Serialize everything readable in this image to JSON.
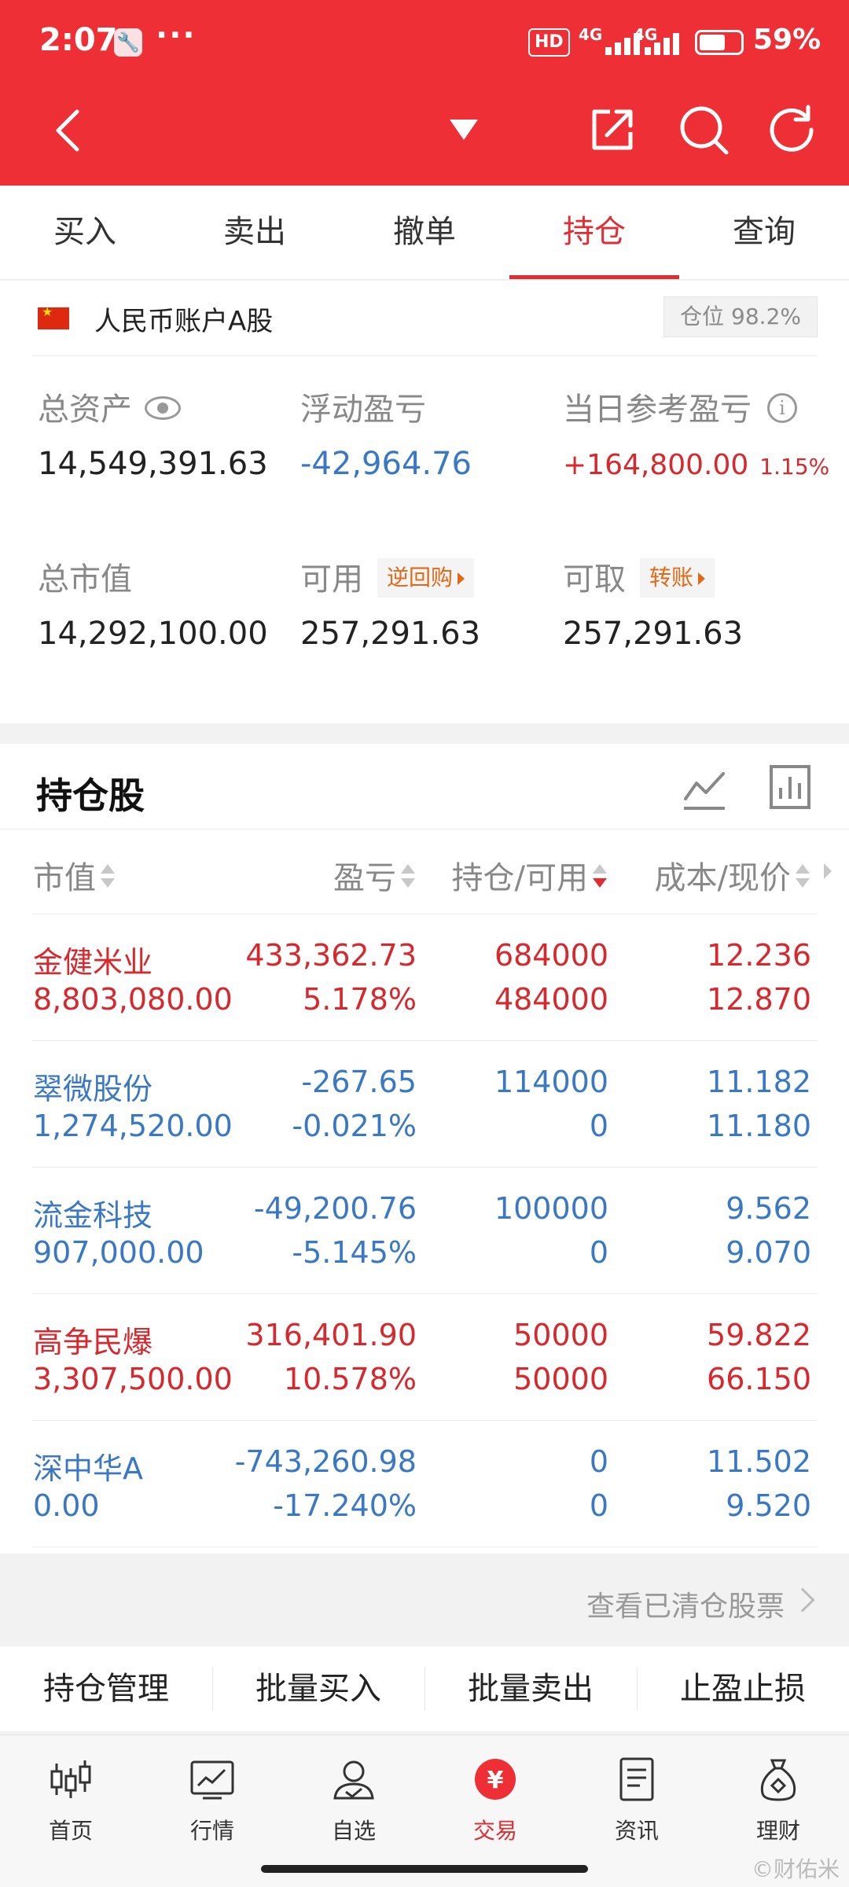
{
  "status_bar": {
    "time": "2:07",
    "dots": "···",
    "hd": "HD",
    "sig1": "4G",
    "sig2": "4G",
    "battery": "59%"
  },
  "tabs": [
    {
      "label": "买入",
      "active": false
    },
    {
      "label": "卖出",
      "active": false
    },
    {
      "label": "撤单",
      "active": false
    },
    {
      "label": "持仓",
      "active": true
    },
    {
      "label": "查询",
      "active": false
    }
  ],
  "account": {
    "name": "人民币账户A股",
    "position_label": "仓位 98.2%"
  },
  "summary": {
    "total_assets_label": "总资产",
    "total_assets": "14,549,391.63",
    "float_pl_label": "浮动盈亏",
    "float_pl": "-42,964.76",
    "daily_pl_label": "当日参考盈亏",
    "daily_pl": "+164,800.00",
    "daily_pct": "1.15%",
    "market_value_label": "总市值",
    "market_value": "14,292,100.00",
    "available_label": "可用",
    "available_btn": "逆回购",
    "available": "257,291.63",
    "withdrawable_label": "可取",
    "withdrawable_btn": "转账",
    "withdrawable": "257,291.63"
  },
  "holdings": {
    "title": "持仓股",
    "col_market_value": "市值",
    "col_pl": "盈亏",
    "col_position": "持仓/可用",
    "col_cost": "成本/现价",
    "rows": [
      {
        "name": "金健米业",
        "value": "8,803,080.00",
        "pl": "433,362.73",
        "pl_pct": "5.178%",
        "hold": "684000",
        "avail": "484000",
        "cost": "12.236",
        "price": "12.870",
        "color": "#d7282e"
      },
      {
        "name": "翠微股份",
        "value": "1,274,520.00",
        "pl": "-267.65",
        "pl_pct": "-0.021%",
        "hold": "114000",
        "avail": "0",
        "cost": "11.182",
        "price": "11.180",
        "color": "#3b78c4"
      },
      {
        "name": "流金科技",
        "value": "907,000.00",
        "pl": "-49,200.76",
        "pl_pct": "-5.145%",
        "hold": "100000",
        "avail": "0",
        "cost": "9.562",
        "price": "9.070",
        "color": "#3b78c4"
      },
      {
        "name": "高争民爆",
        "value": "3,307,500.00",
        "pl": "316,401.90",
        "pl_pct": "10.578%",
        "hold": "50000",
        "avail": "50000",
        "cost": "59.822",
        "price": "66.150",
        "color": "#d7282e"
      },
      {
        "name": "深中华A",
        "value": "0.00",
        "pl": "-743,260.98",
        "pl_pct": "-17.240%",
        "hold": "0",
        "avail": "0",
        "cost": "11.502",
        "price": "9.520",
        "color": "#3b78c4"
      }
    ],
    "cleared_link": "查看已清仓股票"
  },
  "actions": [
    "持仓管理",
    "批量买入",
    "批量卖出",
    "止盈止损"
  ],
  "bottom_nav": [
    {
      "label": "首页",
      "icon": "candlestick-icon"
    },
    {
      "label": "行情",
      "icon": "market-chart-icon"
    },
    {
      "label": "自选",
      "icon": "watchlist-person-icon"
    },
    {
      "label": "交易",
      "icon": "yuan-trade-icon"
    },
    {
      "label": "资讯",
      "icon": "news-document-icon"
    },
    {
      "label": "理财",
      "icon": "money-bag-icon"
    }
  ],
  "watermark": "©财佑米",
  "colors": {
    "brand_red": "#ee2f36",
    "gain_red": "#d7282e",
    "loss_blue": "#3b78c4",
    "accent_orange": "#e06a18"
  }
}
